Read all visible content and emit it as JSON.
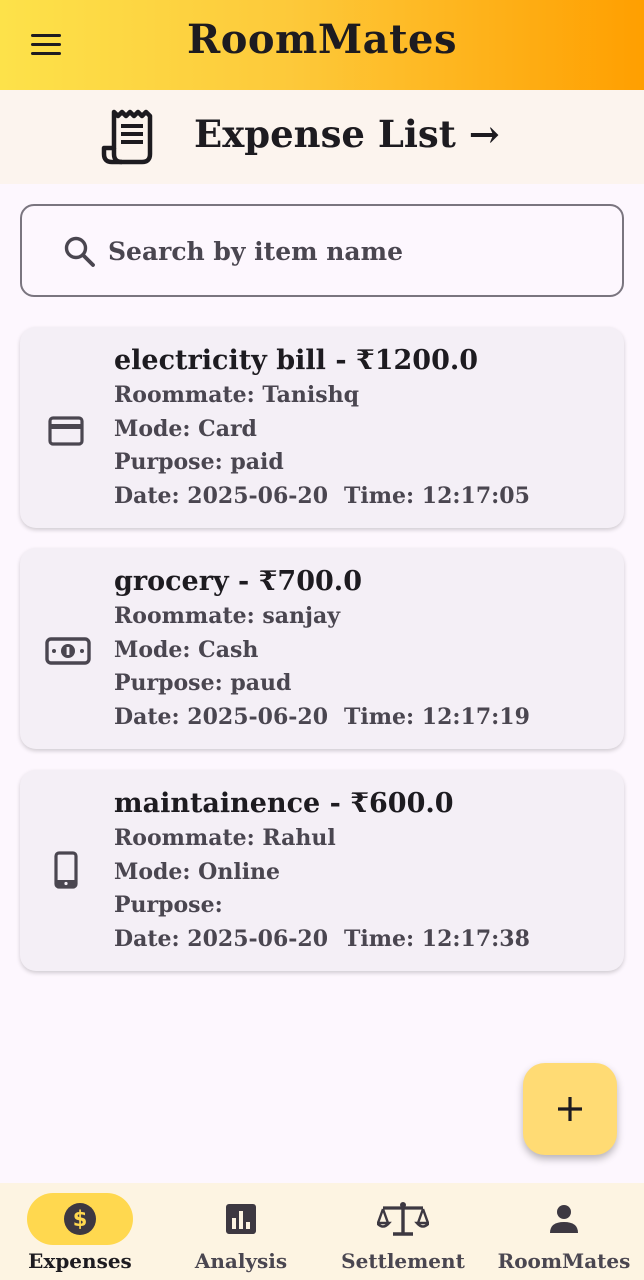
{
  "app_bar": {
    "title": "RoomMates",
    "menu_icon": "hamburger-menu-icon",
    "gradient": [
      "#fde24a",
      "#ff9f00"
    ]
  },
  "header": {
    "icon": "receipt-icon",
    "title": "Expense List →"
  },
  "search": {
    "icon": "search-icon",
    "placeholder": "Search by item name",
    "value": ""
  },
  "expenses": [
    {
      "title": "electricity bill - ₹1200.0",
      "roommate": "Roommate: Tanishq",
      "mode": "Mode: Card",
      "purpose": "Purpose: paid",
      "date": "Date: 2025-06-20",
      "time": "Time: 12:17:05",
      "icon": "credit-card-icon"
    },
    {
      "title": "grocery - ₹700.0",
      "roommate": "Roommate: sanjay",
      "mode": "Mode: Cash",
      "purpose": "Purpose: paud",
      "date": "Date: 2025-06-20",
      "time": "Time: 12:17:19",
      "icon": "cash-icon"
    },
    {
      "title": "maintainence - ₹600.0",
      "roommate": "Roommate: Rahul",
      "mode": "Mode: Online",
      "purpose": "Purpose: ",
      "date": "Date: 2025-06-20",
      "time": "Time: 12:17:38",
      "icon": "smartphone-icon"
    }
  ],
  "fab": {
    "icon": "plus-icon"
  },
  "bottom_nav": {
    "active_color": "#ffd84f",
    "items": [
      {
        "label": "Expenses",
        "icon": "dollar-coin-icon",
        "active": true
      },
      {
        "label": "Analysis",
        "icon": "bar-chart-icon",
        "active": false
      },
      {
        "label": "Settlement",
        "icon": "balance-scale-icon",
        "active": false
      },
      {
        "label": "RoomMates",
        "icon": "person-icon",
        "active": false
      }
    ]
  }
}
